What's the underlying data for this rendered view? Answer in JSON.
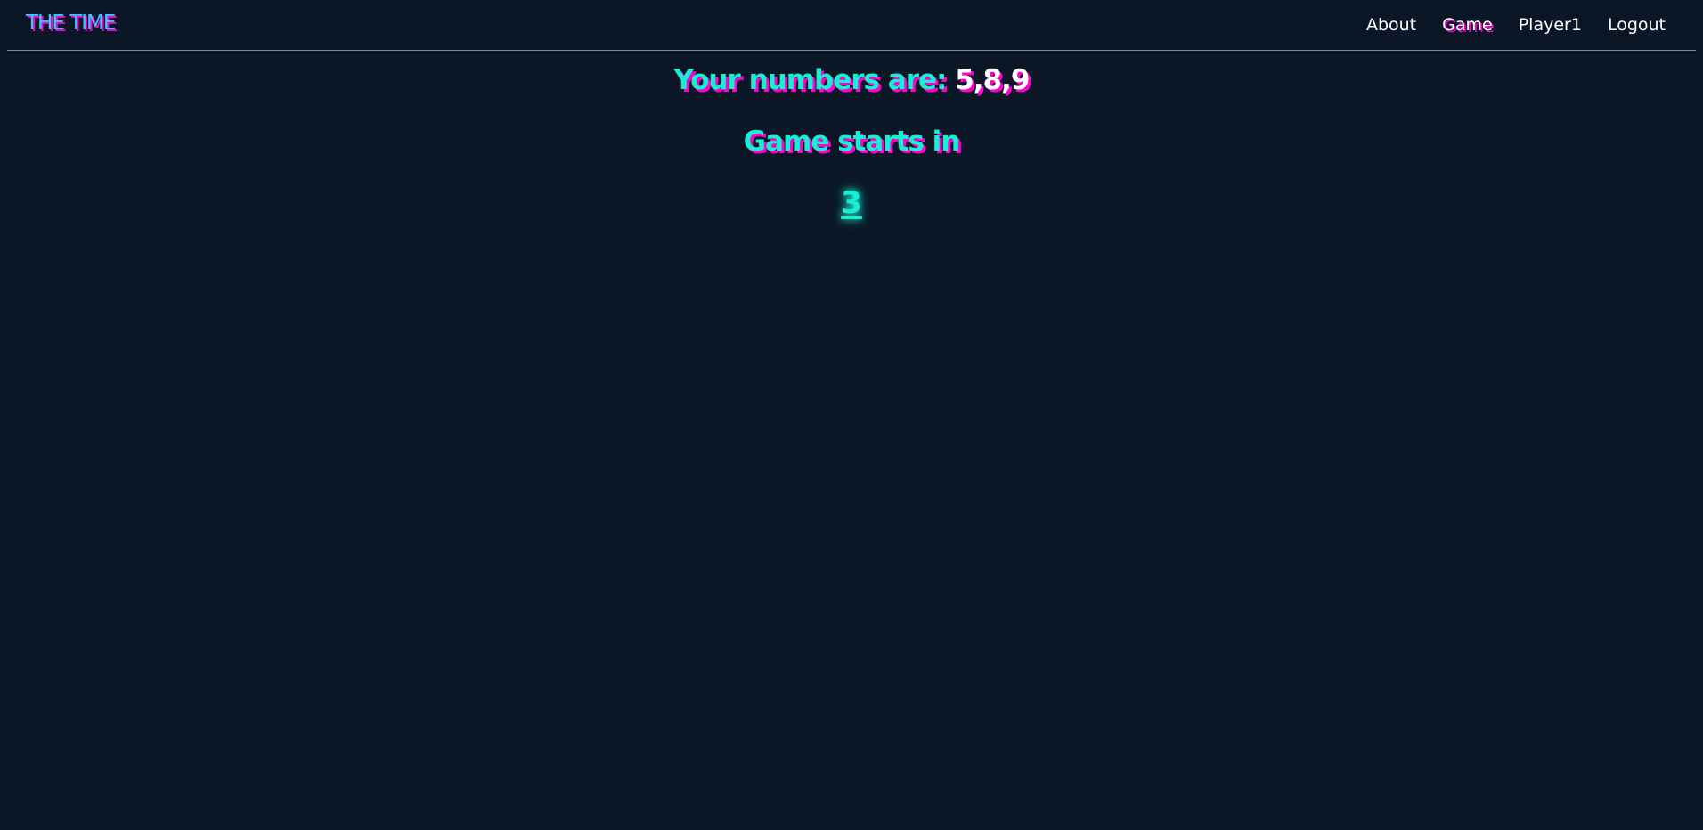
{
  "brand": {
    "title": "THE TIME"
  },
  "nav": {
    "items": [
      {
        "label": "About"
      },
      {
        "label": "Game",
        "active": true
      },
      {
        "label": "Player1"
      },
      {
        "label": "Logout"
      }
    ]
  },
  "main": {
    "numbers_label": "Your numbers are:",
    "numbers_value": "5,8,9",
    "start_label": "Game starts in",
    "countdown": "3"
  },
  "colors": {
    "background": "#0b1726",
    "accent_cyan": "#16f0d2",
    "accent_pink": "#ff00d0",
    "brand_blue": "#38c8ff",
    "text_white": "#ffffff"
  }
}
